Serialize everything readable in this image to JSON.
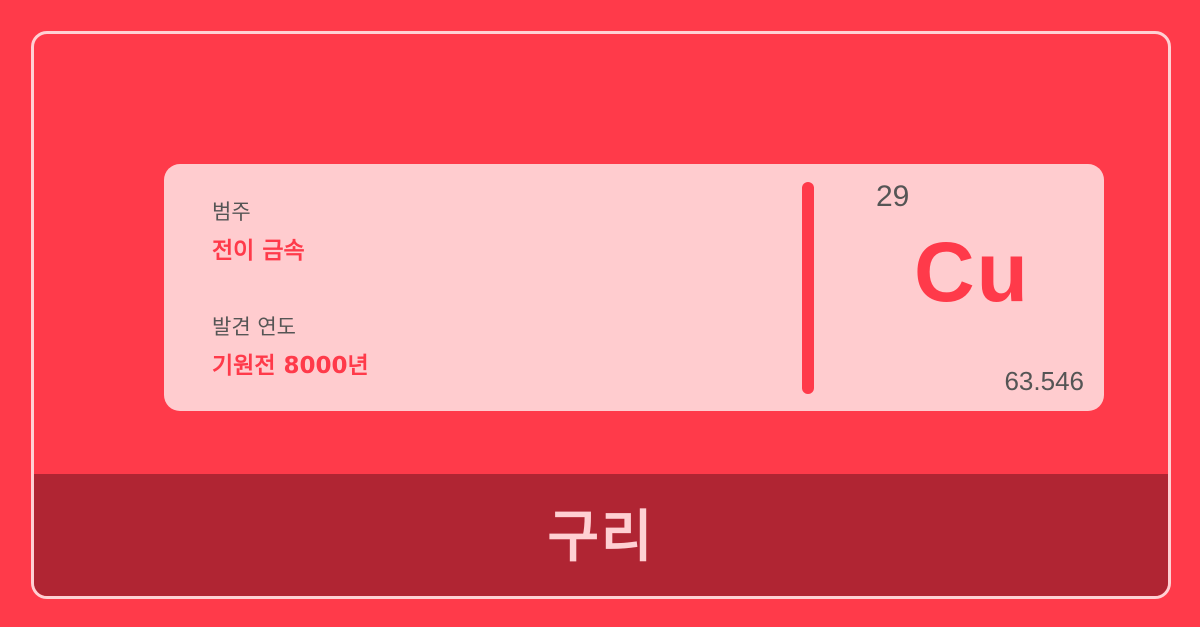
{
  "element": {
    "name": "구리",
    "symbol": "Cu",
    "atomic_number": "29",
    "atomic_mass": "63.546"
  },
  "fields": {
    "category_label": "범주",
    "category_value": "전이 금속",
    "discovery_label": "발견 연도",
    "discovery_value": "기원전 8000년"
  },
  "colors": {
    "background": "#ff3a4a",
    "card": "#ffcccf",
    "footer": "#b02533",
    "border": "#ffd0d3",
    "accent": "#ff3a4a",
    "muted_text": "#555555"
  }
}
